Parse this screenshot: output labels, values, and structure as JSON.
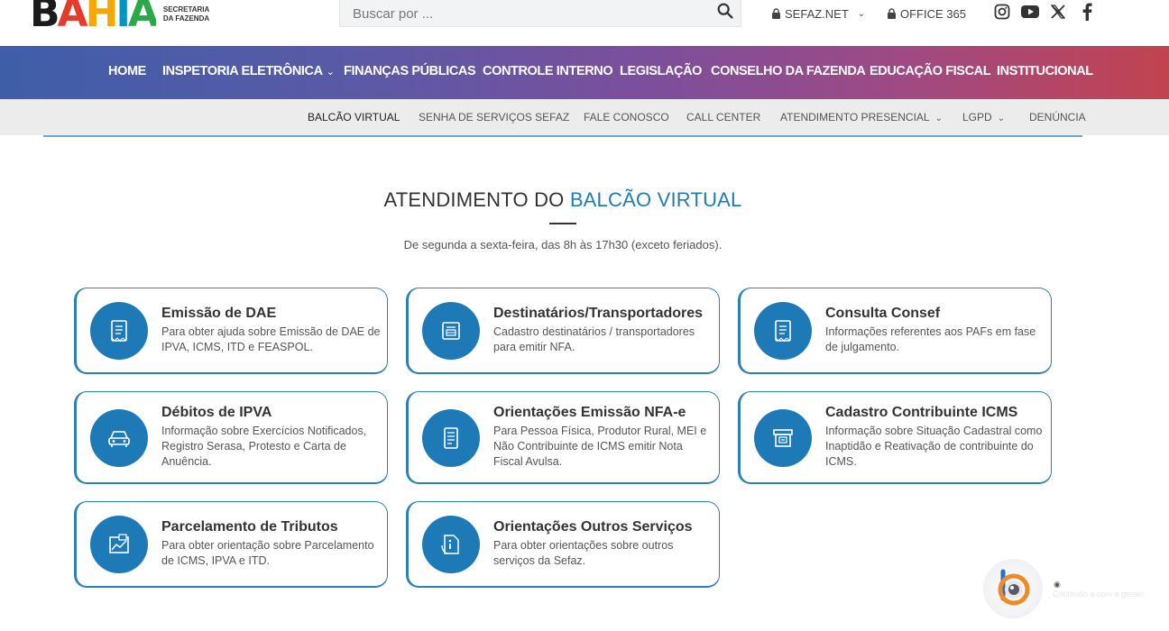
{
  "header": {
    "logo_text": "BAHIA",
    "logo_sub_line1": "SECRETARIA",
    "logo_sub_line2": "DA FAZENDA",
    "search_placeholder": "Buscar por ...",
    "sefaz_net": "SEFAZ.NET",
    "office365": "OFFICE 365",
    "social_icons": [
      "instagram-icon",
      "youtube-icon",
      "x-icon",
      "facebook-icon"
    ]
  },
  "mainnav": {
    "items": [
      "HOME",
      "INSPETORIA ELETRÔNICA",
      "FINANÇAS PÚBLICAS",
      "CONTROLE INTERNO",
      "LEGISLAÇÃO",
      "CONSELHO DA FAZENDA",
      "EDUCAÇÃO FISCAL",
      "INSTITUCIONAL"
    ],
    "caret": "⌄"
  },
  "subnav": {
    "items": [
      "BALCÃO VIRTUAL",
      "SENHA DE SERVIÇOS SEFAZ",
      "FALE CONOSCO",
      "CALL CENTER",
      "ATENDIMENTO PRESENCIAL",
      "LGPD",
      "DENÚNCIA"
    ]
  },
  "main": {
    "title_prefix": "ATENDIMENTO DO ",
    "title_accent": "BALCÃO VIRTUAL",
    "subtitle": "De segunda a sexta-feira, das 8h às 17h30 (exceto feriados).",
    "cards": [
      {
        "title": "Emissão de DAE",
        "desc": "Para obter ajuda sobre Emissão de DAE de IPVA, ICMS, ITD e FEASPOL.",
        "icon": "document-icon"
      },
      {
        "title": "Destinatários/Transportadores",
        "desc": "Cadastro destinatários / transportadores para emitir NFA.",
        "icon": "register-icon"
      },
      {
        "title": "Consulta Consef",
        "desc": "Informações referentes aos PAFs em fase de julgamento.",
        "icon": "document-icon"
      },
      {
        "title": "Débitos de IPVA",
        "desc": "Informação sobre Exercícios Notificados, Registro Serasa, Protesto e Carta de Anuência.",
        "icon": "car-icon"
      },
      {
        "title": "Orientações Emissão NFA-e",
        "desc": "Para Pessoa Física, Produtor Rural, MEI e Não Contribuinte de ICMS emitir Nota Fiscal Avulsa.",
        "icon": "invoice-icon"
      },
      {
        "title": "Cadastro Contribuinte ICMS",
        "desc": "Informação sobre Situação Cadastral como Inaptidão e Reativação de contribuinte do ICMS.",
        "icon": "registry-box-icon"
      },
      {
        "title": "Parcelamento de Tributos",
        "desc": "Para obter orientação sobre Parcelamento de ICMS, IPVA e ITD.",
        "icon": "chart-document-icon"
      },
      {
        "title": "Orientações Outros Serviços",
        "desc": "Para obter orientações sobre outros serviços da Sefaz.",
        "icon": "info-document-icon"
      }
    ]
  },
  "widget": {
    "caption": "Conteúdo é com a gente!",
    "dot": "◉"
  },
  "colors": {
    "accent": "#1f7bb5",
    "circle": "#1d7ab6",
    "nav_gradient_start": "#3f5ea8",
    "nav_gradient_end": "#c2434f"
  }
}
